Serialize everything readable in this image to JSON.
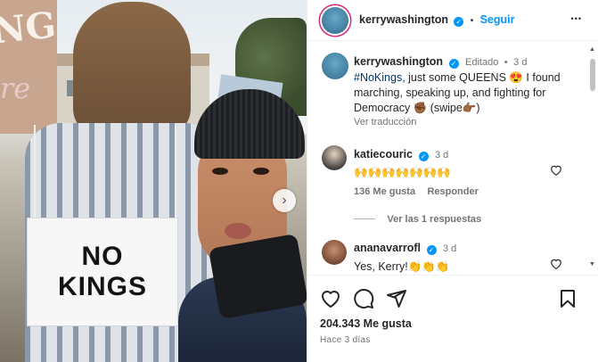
{
  "post": {
    "sign_partial_top": "NG",
    "sign_partial_bottom": "re",
    "blue_sign_text": "",
    "placard_line1": "NO",
    "placard_line2": "KINGS",
    "next_arrow": "›"
  },
  "header": {
    "username": "kerrywashington",
    "verified_mark": "✓",
    "separator": "•",
    "follow_label": "Seguir",
    "more_icon": "•••"
  },
  "caption": {
    "username": "kerrywashington",
    "edited_label": "Editado",
    "separator": "•",
    "time": "3 d",
    "hashtag": "#NoKings",
    "text": ", just some QUEENS 😍 I found marching, speaking up, and fighting for Democracy ✊🏾 (swipe👉🏾)",
    "translate_label": "Ver traducción"
  },
  "comments": [
    {
      "username": "katiecouric",
      "time": "3 d",
      "text": "🙌🙌🙌🙌🙌🙌🙌",
      "likes": "136 Me gusta",
      "reply_label": "Responder",
      "view_replies": "Ver las 1 respuestas"
    },
    {
      "username": "ananavarrofl",
      "time": "3 d",
      "text": "Yes, Kerry!👏👏👏"
    }
  ],
  "footer": {
    "likes": "204.343 Me gusta",
    "posted": "Hace 3 días"
  },
  "colors": {
    "accent": "#0095f6",
    "text": "#262626",
    "secondary": "#737373",
    "hashtag": "#00376b"
  },
  "icons": {
    "like": "heart-icon",
    "comment": "comment-icon",
    "share": "paper-plane-icon",
    "save": "bookmark-icon"
  }
}
